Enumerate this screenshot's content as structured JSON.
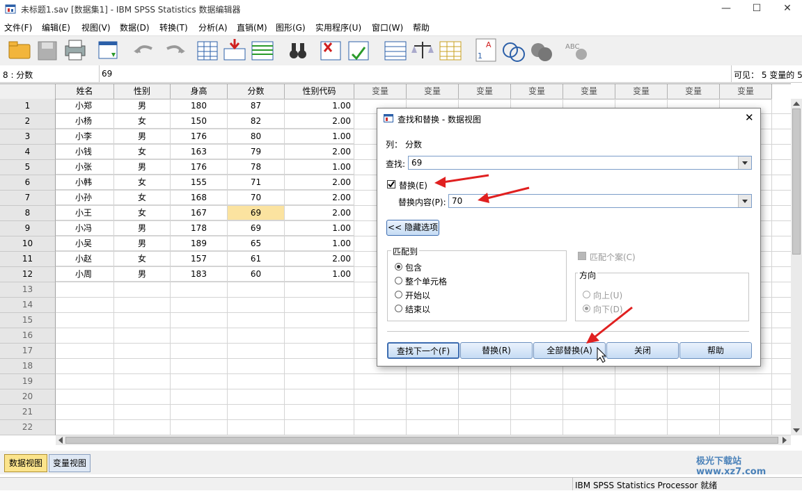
{
  "window": {
    "title": "未标题1.sav [数据集1] - IBM SPSS Statistics 数据编辑器",
    "minimize": "—",
    "maximize": "☐",
    "close": "✕"
  },
  "menu": [
    "文件(F)",
    "编辑(E)",
    "视图(V)",
    "数据(D)",
    "转换(T)",
    "分析(A)",
    "直销(M)",
    "图形(G)",
    "实用程序(U)",
    "窗口(W)",
    "帮助"
  ],
  "toolbar_icons": [
    "open-icon",
    "save-icon",
    "print-icon",
    "dialog-recall-icon",
    "undo-icon",
    "redo-icon",
    "goto-case-icon",
    "goto-variable-icon",
    "variables-icon",
    "find-icon",
    "insert-cases-icon",
    "insert-variable-icon",
    "split-file-icon",
    "weight-cases-icon",
    "select-cases-icon",
    "value-labels-icon",
    "use-sets-icon",
    "show-all-variables-icon",
    "spelling-icon"
  ],
  "cellbar": {
    "ref": "8 : 分数",
    "value": "69",
    "visible": "可见： 5 变量的 5"
  },
  "columns": [
    "姓名",
    "性别",
    "身高",
    "分数",
    "性别代码",
    "变量",
    "变量",
    "变量",
    "变量",
    "变量",
    "变量",
    "变量",
    "变量"
  ],
  "rows": [
    [
      "小郑",
      "男",
      "180",
      "87",
      "1.00"
    ],
    [
      "小杨",
      "女",
      "150",
      "82",
      "2.00"
    ],
    [
      "小李",
      "男",
      "176",
      "80",
      "1.00"
    ],
    [
      "小钱",
      "女",
      "163",
      "79",
      "2.00"
    ],
    [
      "小张",
      "男",
      "176",
      "78",
      "1.00"
    ],
    [
      "小韩",
      "女",
      "155",
      "71",
      "2.00"
    ],
    [
      "小孙",
      "女",
      "168",
      "70",
      "2.00"
    ],
    [
      "小王",
      "女",
      "167",
      "69",
      "2.00"
    ],
    [
      "小冯",
      "男",
      "178",
      "69",
      "1.00"
    ],
    [
      "小吴",
      "男",
      "189",
      "65",
      "1.00"
    ],
    [
      "小赵",
      "女",
      "157",
      "61",
      "2.00"
    ],
    [
      "小周",
      "男",
      "183",
      "60",
      "1.00"
    ]
  ],
  "row_numbers": [
    "1",
    "2",
    "3",
    "4",
    "5",
    "6",
    "7",
    "8",
    "9",
    "10",
    "11",
    "12",
    "13",
    "14",
    "15",
    "16",
    "17",
    "18",
    "19",
    "20",
    "21",
    "22"
  ],
  "tabs": {
    "data_view": "数据视图",
    "variable_view": "变量视图"
  },
  "status": "IBM SPSS Statistics Processor 就绪",
  "watermark": "极光下载站 www.xz7.com",
  "dialog": {
    "title": "查找和替换 - 数据视图",
    "column_label": "列：",
    "column_value": "分数",
    "find_label": "查找:",
    "find_value": "69",
    "replace_checkbox": "替换(E)",
    "replace_checked": true,
    "replace_with_label": "替换内容(P):",
    "replace_with_value": "70",
    "hide_options": "<< 隐藏选项",
    "match_group": "匹配到",
    "match_options": [
      "包含",
      "整个单元格",
      "开始以",
      "结束以"
    ],
    "match_selected": 0,
    "match_case": "匹配个案(C)",
    "direction_group": "方向",
    "direction_options": [
      "向上(U)",
      "向下(D)"
    ],
    "direction_selected": 1,
    "buttons": {
      "find_next": "查找下一个(F)",
      "replace": "替换(R)",
      "replace_all": "全部替换(A)",
      "close": "关闭",
      "help": "帮助"
    }
  },
  "colors": {
    "selected_cell": "#fbe3a0",
    "annotation_arrow": "#e02020",
    "active_tab": "#fbe48c"
  }
}
